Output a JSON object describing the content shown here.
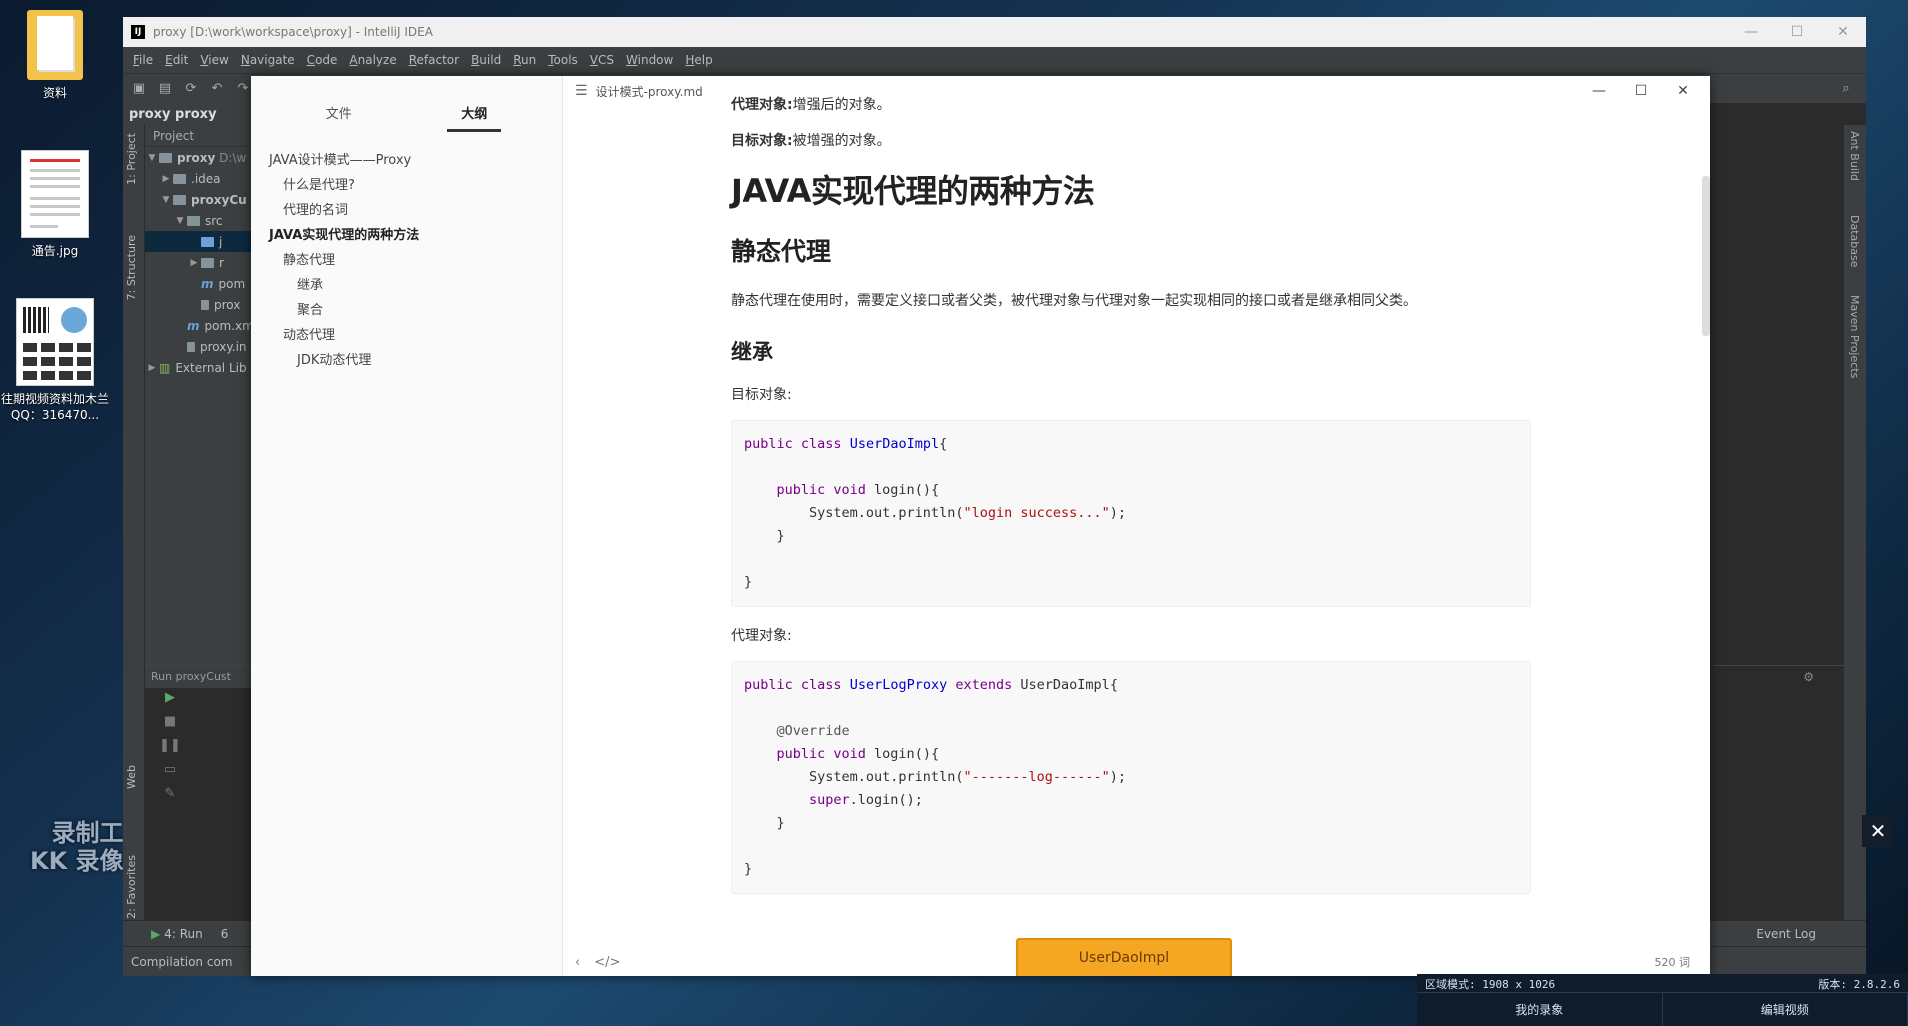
{
  "desktop": {
    "icons": [
      {
        "label": "资料"
      },
      {
        "label": "通告.jpg"
      },
      {
        "label": "往期视频资料加木兰QQ：316470..."
      }
    ],
    "watermark": [
      "录制工具",
      "KK 录像机"
    ]
  },
  "ide": {
    "title": "proxy [D:\\work\\workspace\\proxy] - IntelliJ IDEA",
    "menu": [
      "File",
      "Edit",
      "View",
      "Navigate",
      "Code",
      "Analyze",
      "Refactor",
      "Build",
      "Run",
      "Tools",
      "VCS",
      "Window",
      "Help"
    ],
    "breadcrumb": "proxy  proxy",
    "left_tabs": [
      "1: Project",
      "7: Structure",
      "Web",
      "2: Favorites"
    ],
    "right_tabs": [
      "Ant Build",
      "Database",
      "Maven Projects"
    ],
    "project": {
      "header": "Project",
      "rows": [
        {
          "label": "proxy",
          "suffix": "D:\\w"
        },
        {
          "label": ".idea"
        },
        {
          "label": "proxyCu"
        },
        {
          "label": "src"
        },
        {
          "label": "j"
        },
        {
          "label": "r"
        },
        {
          "label": "pom"
        },
        {
          "label": "prox"
        },
        {
          "label": "pom.xml"
        },
        {
          "label": "proxy.in"
        },
        {
          "label": "External Lib"
        }
      ]
    },
    "run_header": "Run   proxyCust",
    "bottom_tabs": [
      "4: Run",
      "6"
    ],
    "event_log": "Event Log",
    "status": "Compilation com"
  },
  "typora": {
    "sidebar_tabs": [
      "文件",
      "大纲"
    ],
    "outline": [
      {
        "text": "JAVA设计模式——Proxy",
        "level": 1
      },
      {
        "text": "什么是代理?",
        "level": 2
      },
      {
        "text": "代理的名词",
        "level": 2
      },
      {
        "text": "JAVA实现代理的两种方法",
        "level": 1
      },
      {
        "text": "静态代理",
        "level": 2
      },
      {
        "text": "继承",
        "level": 3
      },
      {
        "text": "聚合",
        "level": 3
      },
      {
        "text": "动态代理",
        "level": 2
      },
      {
        "text": "JDK动态代理",
        "level": 3
      }
    ],
    "file_name": "设计模式-proxy.md",
    "word_count": "520 词",
    "doc": {
      "line1_b": "代理对象:",
      "line1": "增强后的对象。",
      "line2_b": "目标对象:",
      "line2": "被增强的对象。",
      "h1": "JAVA实现代理的两种方法",
      "h2": "静态代理",
      "para": "静态代理在使用时，需要定义接口或者父类，被代理对象与代理对象一起实现相同的接口或者是继承相同父类。",
      "h3": "继承",
      "target_label": "目标对象:",
      "proxy_label": "代理对象:"
    },
    "find_button": "UserDaoImpl"
  },
  "recorder": {
    "mode": "区域模式: 1908 x 1026",
    "version": "版本: 2.8.2.6",
    "buttons": [
      "我的录象",
      "编辑视频"
    ]
  }
}
